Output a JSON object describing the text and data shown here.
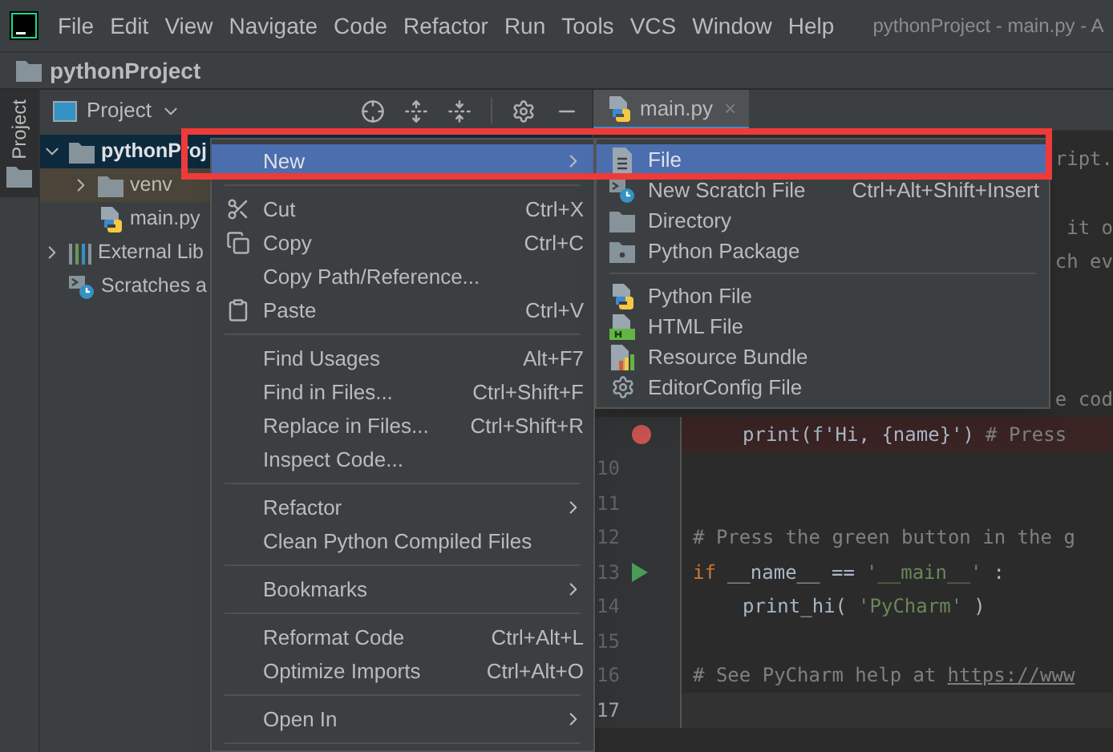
{
  "menu_bar": {
    "items": [
      "File",
      "Edit",
      "View",
      "Navigate",
      "Code",
      "Refactor",
      "Run",
      "Tools",
      "VCS",
      "Window",
      "Help"
    ],
    "title": "pythonProject - main.py - A"
  },
  "nav_bar": {
    "crumb": "pythonProject"
  },
  "tool_strip": {
    "tab": "Project",
    "selected": true
  },
  "project_panel": {
    "title": "Project",
    "tree": [
      {
        "label": "pythonProj",
        "expanded": true,
        "selected": true,
        "children": [
          {
            "label": "venv",
            "expanded": false,
            "excluded": true,
            "selected": false
          },
          {
            "label": "main.py",
            "selected": false
          }
        ]
      },
      {
        "label": "External Lib",
        "expanded": false,
        "selected": false
      },
      {
        "label": "Scratches a",
        "selected": false
      }
    ]
  },
  "editor": {
    "tab": {
      "label": "main.py",
      "close": "×",
      "selected": true
    },
    "lines": [
      {
        "kind": "fragment",
        "text": "ript."
      },
      {
        "kind": "fragment"
      },
      {
        "kind": "fragment",
        "text": "it o"
      },
      {
        "kind": "fragment",
        "text": "ch ev"
      },
      {
        "kind": "fragment"
      },
      {
        "kind": "fragment"
      },
      {
        "kind": "fragment"
      },
      {
        "kind": "fragment",
        "text": "e cod"
      },
      {
        "kind": "code",
        "breakpoint": true,
        "indented": true,
        "tokens": [
          {
            "kind": "plain",
            "text": "print(f'Hi, {name}')"
          },
          {
            "kind": "comment",
            "text": "# Press"
          }
        ]
      },
      {
        "kind": "code",
        "number": "10"
      },
      {
        "kind": "code",
        "number": "11"
      },
      {
        "kind": "code",
        "number": "12",
        "tokens": [
          {
            "kind": "comment",
            "text": "# Press the green button in the g"
          }
        ]
      },
      {
        "kind": "code",
        "number": "13",
        "run": true,
        "tokens": [
          {
            "kind": "keyword",
            "text": "if"
          },
          {
            "kind": "plain",
            "text": "__name__ =="
          },
          {
            "kind": "string",
            "text": "'__main__'"
          },
          {
            "kind": "plain",
            "text": ":"
          }
        ]
      },
      {
        "kind": "code",
        "number": "14",
        "indented": true,
        "tokens": [
          {
            "kind": "plain",
            "text": "print_hi("
          },
          {
            "kind": "string",
            "text": "'PyCharm'"
          },
          {
            "kind": "plain",
            "text": ")"
          }
        ]
      },
      {
        "kind": "code",
        "number": "15"
      },
      {
        "kind": "code",
        "number": "16",
        "tokens": [
          {
            "kind": "comment",
            "text": "# See PyCharm help at"
          },
          {
            "kind": "link",
            "text": "https://www"
          }
        ]
      },
      {
        "kind": "code",
        "number": "17",
        "current": true
      }
    ]
  },
  "context_menu": {
    "items": [
      {
        "kind": "item",
        "label": "New",
        "submenu": true,
        "selected": true
      },
      {
        "kind": "separator"
      },
      {
        "kind": "item",
        "label": "Cut",
        "shortcut": "Ctrl+X",
        "selected": false
      },
      {
        "kind": "item",
        "label": "Copy",
        "shortcut": "Ctrl+C",
        "selected": false
      },
      {
        "kind": "item",
        "label": "Copy Path/Reference...",
        "selected": false
      },
      {
        "kind": "item",
        "label": "Paste",
        "shortcut": "Ctrl+V",
        "selected": false
      },
      {
        "kind": "separator"
      },
      {
        "kind": "item",
        "label": "Find Usages",
        "shortcut": "Alt+F7",
        "selected": false
      },
      {
        "kind": "item",
        "label": "Find in Files...",
        "shortcut": "Ctrl+Shift+F",
        "selected": false
      },
      {
        "kind": "item",
        "label": "Replace in Files...",
        "shortcut": "Ctrl+Shift+R",
        "selected": false
      },
      {
        "kind": "item",
        "label": "Inspect Code...",
        "selected": false
      },
      {
        "kind": "separator"
      },
      {
        "kind": "item",
        "label": "Refactor",
        "submenu": true,
        "selected": false
      },
      {
        "kind": "item",
        "label": "Clean Python Compiled Files",
        "selected": false
      },
      {
        "kind": "separator"
      },
      {
        "kind": "item",
        "label": "Bookmarks",
        "submenu": true,
        "selected": false
      },
      {
        "kind": "separator"
      },
      {
        "kind": "item",
        "label": "Reformat Code",
        "shortcut": "Ctrl+Alt+L",
        "selected": false
      },
      {
        "kind": "item",
        "label": "Optimize Imports",
        "shortcut": "Ctrl+Alt+O",
        "selected": false
      },
      {
        "kind": "separator"
      },
      {
        "kind": "item",
        "label": "Open In",
        "submenu": true,
        "selected": false
      },
      {
        "kind": "separator"
      }
    ]
  },
  "new_submenu": {
    "items": [
      {
        "kind": "item",
        "label": "File",
        "selected": true
      },
      {
        "kind": "item",
        "label": "New Scratch File",
        "shortcut": "Ctrl+Alt+Shift+Insert",
        "selected": false
      },
      {
        "kind": "item",
        "label": "Directory",
        "selected": false
      },
      {
        "kind": "item",
        "label": "Python Package",
        "selected": false
      },
      {
        "kind": "separator"
      },
      {
        "kind": "item",
        "label": "Python File",
        "selected": false
      },
      {
        "kind": "item",
        "label": "HTML File",
        "selected": false
      },
      {
        "kind": "item",
        "label": "Resource Bundle",
        "selected": false
      },
      {
        "kind": "item",
        "label": "EditorConfig File",
        "selected": false
      }
    ]
  }
}
